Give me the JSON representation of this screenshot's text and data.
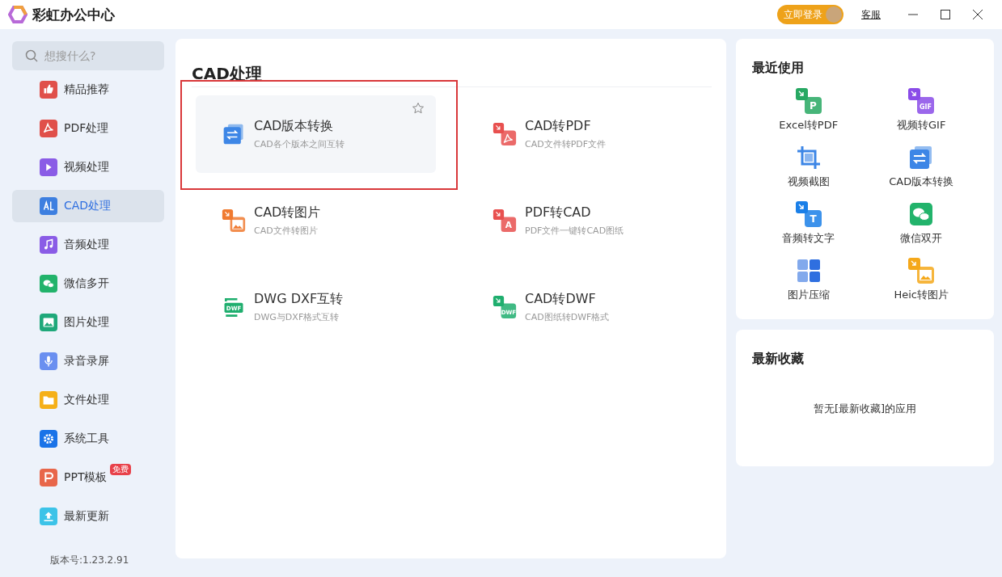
{
  "app": {
    "title": "彩虹办公中心",
    "login": "立即登录",
    "service": "客服"
  },
  "search": {
    "placeholder": "想搜什么?"
  },
  "sidebar": {
    "items": [
      {
        "label": "精品推荐",
        "selected": false,
        "kind": "thumb",
        "color": "#e0504a"
      },
      {
        "label": "PDF处理",
        "selected": false,
        "kind": "pdf",
        "color": "#e0504a"
      },
      {
        "label": "视频处理",
        "selected": false,
        "kind": "play",
        "color": "#8a5ce6"
      },
      {
        "label": "CAD处理",
        "selected": true,
        "kind": "cad",
        "color": "#3d7fe0"
      },
      {
        "label": "音频处理",
        "selected": false,
        "kind": "music",
        "color": "#8a5ce6"
      },
      {
        "label": "微信多开",
        "selected": false,
        "kind": "chat",
        "color": "#22b36b"
      },
      {
        "label": "图片处理",
        "selected": false,
        "kind": "image",
        "color": "#1fa87a"
      },
      {
        "label": "录音录屏",
        "selected": false,
        "kind": "mic",
        "color": "#6a8ff0"
      },
      {
        "label": "文件处理",
        "selected": false,
        "kind": "folder",
        "color": "#f5b018"
      },
      {
        "label": "系统工具",
        "selected": false,
        "kind": "gear",
        "color": "#1a73e8"
      },
      {
        "label": "PPT模板",
        "selected": false,
        "kind": "ppt",
        "color": "#e8664a",
        "badge": "免费"
      },
      {
        "label": "最新更新",
        "selected": false,
        "kind": "upload",
        "color": "#3cc3e8"
      }
    ],
    "version": "版本号:1.23.2.91"
  },
  "main": {
    "title": "CAD处理",
    "tools": [
      {
        "title": "CAD版本转换",
        "subtitle": "CAD各个版本之间互转",
        "icon": {
          "kind": "stack",
          "color": "#3d86e6"
        },
        "hovered": true,
        "highlighted": true
      },
      {
        "title": "CAD转PDF",
        "subtitle": "CAD文件转PDF文件",
        "icon": {
          "kind": "pdf",
          "color": "#e8504f"
        },
        "hovered": false,
        "highlighted": false
      },
      {
        "title": "CAD转图片",
        "subtitle": "CAD文件转图片",
        "icon": {
          "kind": "image",
          "color": "#f07a30"
        },
        "hovered": false,
        "highlighted": false
      },
      {
        "title": "PDF转CAD",
        "subtitle": "PDF文件一键转CAD图纸",
        "icon": {
          "kind": "letter",
          "color": "#e8504f",
          "text": "A"
        },
        "hovered": false,
        "highlighted": false
      },
      {
        "title": "DWG DXF互转",
        "subtitle": "DWG与DXF格式互转",
        "icon": {
          "kind": "cycle",
          "color": "#1fae6e",
          "text": "DWF"
        },
        "hovered": false,
        "highlighted": false
      },
      {
        "title": "CAD转DWF",
        "subtitle": "CAD图纸转DWF格式",
        "icon": {
          "kind": "letter",
          "color": "#1fae6e",
          "text": "DWF"
        },
        "hovered": false,
        "highlighted": false
      }
    ]
  },
  "recent": {
    "title": "最近使用",
    "items": [
      {
        "label": "Excel转PDF",
        "icon": {
          "kind": "letter",
          "color": "#27a862",
          "text": "P"
        }
      },
      {
        "label": "视频转GIF",
        "icon": {
          "kind": "letter",
          "color": "#8a4ce8",
          "text": "GIF"
        }
      },
      {
        "label": "视频截图",
        "icon": {
          "kind": "crop",
          "color": "#3d86e6"
        }
      },
      {
        "label": "CAD版本转换",
        "icon": {
          "kind": "stack",
          "color": "#3d86e6"
        }
      },
      {
        "label": "音频转文字",
        "icon": {
          "kind": "letter",
          "color": "#1a7fe8",
          "text": "T"
        }
      },
      {
        "label": "微信双开",
        "icon": {
          "kind": "chat",
          "color": "#22b36b"
        }
      },
      {
        "label": "图片压缩",
        "icon": {
          "kind": "grid",
          "color": "#2f6fe0"
        }
      },
      {
        "label": "Heic转图片",
        "icon": {
          "kind": "image",
          "color": "#f5a81a"
        }
      }
    ]
  },
  "favorites": {
    "title": "最新收藏",
    "empty": "暂无[最新收藏]的应用"
  }
}
